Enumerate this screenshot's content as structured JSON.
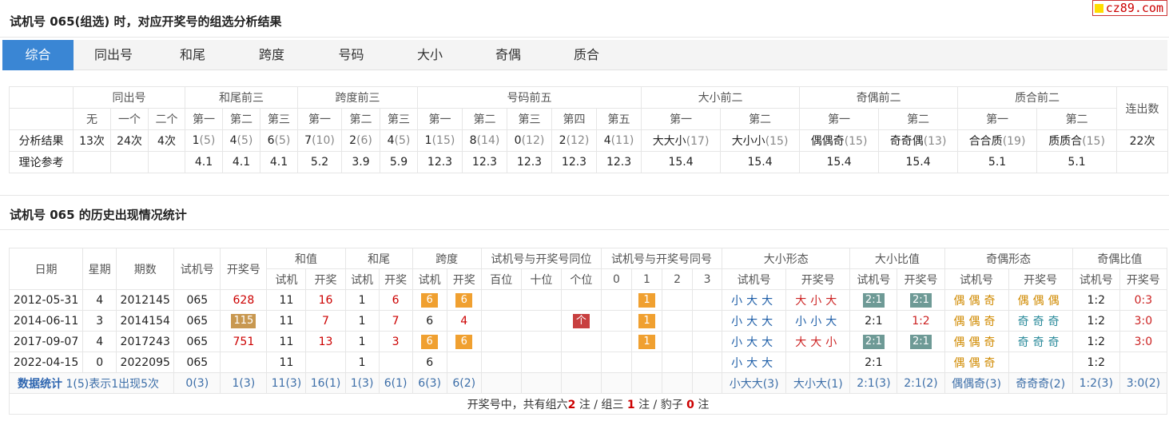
{
  "logo": {
    "text": "cz89.com",
    "icon": "yellow-square"
  },
  "title1": "试机号 065(组选) 时，对应开奖号的组选分析结果",
  "tabs": [
    "综合",
    "同出号",
    "和尾",
    "跨度",
    "号码",
    "大小",
    "奇偶",
    "质合"
  ],
  "active_tab": "综合",
  "analysis": {
    "groups": [
      "同出号",
      "和尾前三",
      "跨度前三",
      "号码前五",
      "大小前二",
      "奇偶前二",
      "质合前二",
      "连出数"
    ],
    "subheaders": [
      "无",
      "一个",
      "二个",
      "第一",
      "第二",
      "第三",
      "第一",
      "第二",
      "第三",
      "第一",
      "第二",
      "第三",
      "第四",
      "第五",
      "第一",
      "第二",
      "第一",
      "第二",
      "第一",
      "第二"
    ],
    "result_label": "分析结果",
    "result": [
      {
        "v": "13次",
        "c": ""
      },
      {
        "v": "24次",
        "c": ""
      },
      {
        "v": "4次",
        "c": ""
      },
      {
        "v": "1",
        "c": "(5)"
      },
      {
        "v": "4",
        "c": "(5)"
      },
      {
        "v": "6",
        "c": "(5)"
      },
      {
        "v": "7",
        "c": "(10)"
      },
      {
        "v": "2",
        "c": "(6)"
      },
      {
        "v": "4",
        "c": "(5)"
      },
      {
        "v": "1",
        "c": "(15)"
      },
      {
        "v": "8",
        "c": "(14)"
      },
      {
        "v": "0",
        "c": "(12)"
      },
      {
        "v": "2",
        "c": "(12)"
      },
      {
        "v": "4",
        "c": "(11)"
      },
      {
        "v": "大大小",
        "c": "(17)"
      },
      {
        "v": "大小小",
        "c": "(15)"
      },
      {
        "v": "偶偶奇",
        "c": "(15)"
      },
      {
        "v": "奇奇偶",
        "c": "(13)"
      },
      {
        "v": "合合质",
        "c": "(19)"
      },
      {
        "v": "质质合",
        "c": "(15)"
      },
      {
        "v": "22次",
        "c": ""
      }
    ],
    "theory_label": "理论参考",
    "theory": [
      "",
      "",
      "",
      "4.1",
      "4.1",
      "4.1",
      "5.2",
      "3.9",
      "5.9",
      "12.3",
      "12.3",
      "12.3",
      "12.3",
      "12.3",
      "15.4",
      "15.4",
      "15.4",
      "15.4",
      "5.1",
      "5.1",
      ""
    ]
  },
  "title2": "试机号 065 的历史出现情况统计",
  "history": {
    "h_date": "日期",
    "h_week": "星期",
    "h_issue": "期数",
    "h_test": "试机号",
    "h_draw": "开奖号",
    "groups": [
      "和值",
      "和尾",
      "跨度",
      "试机号与开奖号同位",
      "试机号与开奖号同号",
      "大小形态",
      "大小比值",
      "奇偶形态",
      "奇偶比值"
    ],
    "sub": [
      "试机",
      "开奖",
      "试机",
      "开奖",
      "试机",
      "开奖",
      "百位",
      "十位",
      "个位",
      "0",
      "1",
      "2",
      "3",
      "试机号",
      "开奖号",
      "试机号",
      "开奖号",
      "试机号",
      "开奖号",
      "试机号",
      "开奖号"
    ],
    "rows": [
      {
        "date": "2012-05-31",
        "week": "4",
        "issue": "2012145",
        "test": "065",
        "draw": "628",
        "sum_t": "11",
        "sum_d": "16",
        "tail_t": "1",
        "tail_d": "6",
        "span_t": "6",
        "span_d": "6",
        "pos_g": "",
        "same_1": "1",
        "bs_t": "小大大",
        "bs_d": "大小大",
        "bsr_t": "2:1",
        "bsr_d": "2:1",
        "oe_t": "偶偶奇",
        "oe_d": "偶偶偶",
        "oer_t": "1:2",
        "oer_d": "0:3"
      },
      {
        "date": "2014-06-11",
        "week": "3",
        "issue": "2014154",
        "test": "065",
        "draw": "115",
        "sum_t": "11",
        "sum_d": "7",
        "tail_t": "1",
        "tail_d": "7",
        "span_t": "6",
        "span_d": "4",
        "pos_g": "个",
        "same_1": "1",
        "bs_t": "小大大",
        "bs_d": "小小大",
        "bsr_t": "2:1",
        "bsr_d": "1:2",
        "oe_t": "偶偶奇",
        "oe_d": "奇奇奇",
        "oer_t": "1:2",
        "oer_d": "3:0"
      },
      {
        "date": "2017-09-07",
        "week": "4",
        "issue": "2017243",
        "test": "065",
        "draw": "751",
        "sum_t": "11",
        "sum_d": "13",
        "tail_t": "1",
        "tail_d": "3",
        "span_t": "6",
        "span_d": "6",
        "pos_g": "",
        "same_1": "1",
        "bs_t": "小大大",
        "bs_d": "大大小",
        "bsr_t": "2:1",
        "bsr_d": "2:1",
        "oe_t": "偶偶奇",
        "oe_d": "奇奇奇",
        "oer_t": "1:2",
        "oer_d": "3:0"
      },
      {
        "date": "2022-04-15",
        "week": "0",
        "issue": "2022095",
        "test": "065",
        "draw": "",
        "sum_t": "11",
        "sum_d": "",
        "tail_t": "1",
        "tail_d": "",
        "span_t": "6",
        "span_d": "",
        "pos_g": "",
        "same_1": "",
        "bs_t": "小大大",
        "bs_d": "",
        "bsr_t": "2:1",
        "bsr_d": "",
        "oe_t": "偶偶奇",
        "oe_d": "",
        "oer_t": "1:2",
        "oer_d": ""
      }
    ],
    "stat": {
      "label": "数据统计",
      "note": "1(5)表示1出现5次",
      "test": "0(3)",
      "draw": "1(3)",
      "sum_t": "11(3)",
      "sum_d": "16(1)",
      "tail_t": "1(3)",
      "tail_d": "6(1)",
      "span_t": "6(3)",
      "span_d": "6(2)",
      "bs_t": "小大大(3)",
      "bs_d": "大小大(1)",
      "bsr_t": "2:1(3)",
      "bsr_d": "2:1(2)",
      "oe_t": "偶偶奇(3)",
      "oe_d": "奇奇奇(2)",
      "oer_t": "1:2(3)",
      "oer_d": "3:0(2)"
    },
    "footer": {
      "pre": "开奖号中，共有组六",
      "n6": "2",
      "mid1": "注 / 组三",
      "n3": "1",
      "mid2": "注 / 豹子",
      "nb": "0",
      "post": "注"
    }
  }
}
